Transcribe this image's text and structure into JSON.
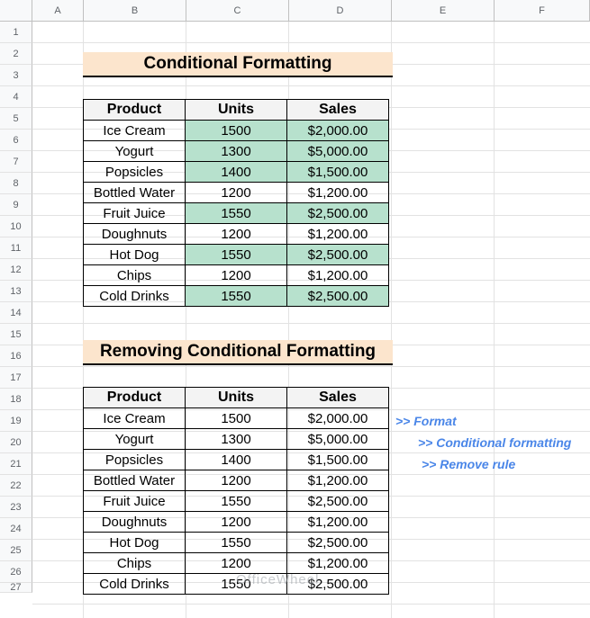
{
  "columns": [
    "",
    "A",
    "B",
    "C",
    "D",
    "E",
    "F"
  ],
  "rows": [
    "1",
    "2",
    "3",
    "4",
    "5",
    "6",
    "7",
    "8",
    "9",
    "10",
    "11",
    "12",
    "13",
    "14",
    "15",
    "16",
    "17",
    "18",
    "19",
    "20",
    "21",
    "22",
    "23",
    "24",
    "25",
    "26",
    "27"
  ],
  "table1": {
    "title": "Conditional Formatting",
    "headers": [
      "Product",
      "Units",
      "Sales"
    ],
    "rows": [
      {
        "product": "Ice Cream",
        "units": "1500",
        "sales": "$2,000.00",
        "highlight": true
      },
      {
        "product": "Yogurt",
        "units": "1300",
        "sales": "$5,000.00",
        "highlight": true
      },
      {
        "product": "Popsicles",
        "units": "1400",
        "sales": "$1,500.00",
        "highlight": true
      },
      {
        "product": "Bottled Water",
        "units": "1200",
        "sales": "$1,200.00",
        "highlight": false
      },
      {
        "product": "Fruit Juice",
        "units": "1550",
        "sales": "$2,500.00",
        "highlight": true
      },
      {
        "product": "Doughnuts",
        "units": "1200",
        "sales": "$1,200.00",
        "highlight": false
      },
      {
        "product": "Hot Dog",
        "units": "1550",
        "sales": "$2,500.00",
        "highlight": true
      },
      {
        "product": "Chips",
        "units": "1200",
        "sales": "$1,200.00",
        "highlight": false
      },
      {
        "product": "Cold Drinks",
        "units": "1550",
        "sales": "$2,500.00",
        "highlight": true
      }
    ]
  },
  "table2": {
    "title": "Removing Conditional Formatting",
    "headers": [
      "Product",
      "Units",
      "Sales"
    ],
    "rows": [
      {
        "product": "Ice Cream",
        "units": "1500",
        "sales": "$2,000.00"
      },
      {
        "product": "Yogurt",
        "units": "1300",
        "sales": "$5,000.00"
      },
      {
        "product": "Popsicles",
        "units": "1400",
        "sales": "$1,500.00"
      },
      {
        "product": "Bottled Water",
        "units": "1200",
        "sales": "$1,200.00"
      },
      {
        "product": "Fruit Juice",
        "units": "1550",
        "sales": "$2,500.00"
      },
      {
        "product": "Doughnuts",
        "units": "1200",
        "sales": "$1,200.00"
      },
      {
        "product": "Hot Dog",
        "units": "1550",
        "sales": "$2,500.00"
      },
      {
        "product": "Chips",
        "units": "1200",
        "sales": "$1,200.00"
      },
      {
        "product": "Cold Drinks",
        "units": "1550",
        "sales": "$2,500.00"
      }
    ]
  },
  "notes": [
    ">> Format",
    ">> Conditional formatting",
    ">> Remove rule"
  ],
  "watermark": "OfficeWheel",
  "colors": {
    "highlight": "#b7e1cd",
    "title_bg": "#fce5cd",
    "note": "#4a86e8"
  }
}
